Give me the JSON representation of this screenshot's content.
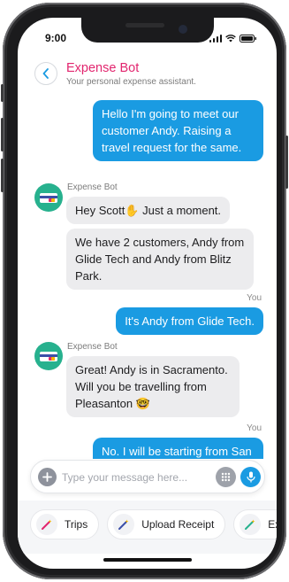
{
  "status_bar": {
    "time": "9:00"
  },
  "header": {
    "title": "Expense Bot",
    "subtitle": "Your personal expense assistant."
  },
  "chat": {
    "you_label": "You",
    "bot_name": "Expense Bot",
    "messages": [
      {
        "from": "user",
        "text": "Hello I'm going to meet our customer Andy. Raising a travel request for the same."
      },
      {
        "from": "bot",
        "text": "Hey Scott✋ Just a moment."
      },
      {
        "from": "bot",
        "text": "We have 2 customers, Andy from Glide Tech and Andy from Blitz Park."
      },
      {
        "from": "user",
        "text": "It's Andy from Glide Tech."
      },
      {
        "from": "bot",
        "text": "Great! Andy is in Sacramento. Will you be travelling from Pleasanton 🤓"
      },
      {
        "from": "user",
        "text": "No. I will be starting from San Jose tomorrow morning."
      }
    ]
  },
  "composer": {
    "placeholder": "Type your message here..."
  },
  "quick_actions": [
    {
      "label": "Trips",
      "icon": "magic-wand-icon",
      "color": "#e2266f"
    },
    {
      "label": "Upload Receipt",
      "icon": "magic-wand-icon",
      "color": "#3b4fa8"
    },
    {
      "label": "Expe",
      "icon": "magic-wand-icon",
      "color": "#27b18e"
    }
  ],
  "colors": {
    "accent": "#1a9be2",
    "title": "#e2266f",
    "bot_avatar": "#27b18e",
    "incoming_bubble": "#ececee"
  }
}
